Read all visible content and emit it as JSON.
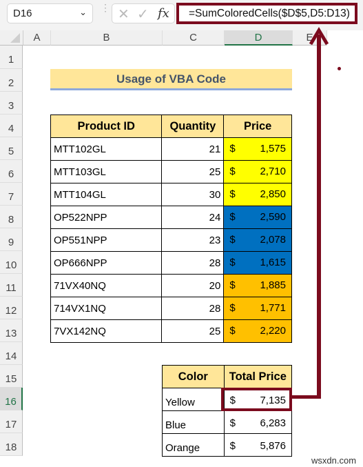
{
  "toolbar": {
    "name_box": "D16",
    "name_box_chevron": "⌄",
    "cancel_icon": "✕",
    "enter_icon": "✓",
    "fx_label": "fx",
    "formula": "=SumColoredCells($D$5,D5:D13)"
  },
  "columns": [
    "A",
    "B",
    "C",
    "D",
    "E"
  ],
  "selected_column": "D",
  "rows": [
    "1",
    "2",
    "3",
    "4",
    "5",
    "6",
    "7",
    "8",
    "9",
    "10",
    "11",
    "12",
    "13",
    "14",
    "15",
    "16",
    "17",
    "18"
  ],
  "selected_row": "16",
  "sheet": {
    "title": "Usage of VBA Code",
    "main_table": {
      "headers": [
        "Product ID",
        "Quantity",
        "Price"
      ],
      "rows": [
        {
          "id": "MTT102GL",
          "qty": "21",
          "cur": "$",
          "price": "1,575",
          "color": "#ffff00"
        },
        {
          "id": "MTT103GL",
          "qty": "25",
          "cur": "$",
          "price": "2,710",
          "color": "#ffff00"
        },
        {
          "id": "MTT104GL",
          "qty": "30",
          "cur": "$",
          "price": "2,850",
          "color": "#ffff00"
        },
        {
          "id": "OP522NPP",
          "qty": "24",
          "cur": "$",
          "price": "2,590",
          "color": "#0070c0"
        },
        {
          "id": "OP551NPP",
          "qty": "23",
          "cur": "$",
          "price": "2,078",
          "color": "#0070c0"
        },
        {
          "id": "OP666NPP",
          "qty": "28",
          "cur": "$",
          "price": "1,615",
          "color": "#0070c0"
        },
        {
          "id": "71VX40NQ",
          "qty": "20",
          "cur": "$",
          "price": "1,885",
          "color": "#ffc000"
        },
        {
          "id": "714VX1NQ",
          "qty": "28",
          "cur": "$",
          "price": "1,771",
          "color": "#ffc000"
        },
        {
          "id": "7VX142NQ",
          "qty": "25",
          "cur": "$",
          "price": "2,220",
          "color": "#ffc000"
        }
      ]
    },
    "summary_table": {
      "headers": [
        "Color",
        "Total Price"
      ],
      "rows": [
        {
          "color": "Yellow",
          "cur": "$",
          "total": "7,135"
        },
        {
          "color": "Blue",
          "cur": "$",
          "total": "6,283"
        },
        {
          "color": "Orange",
          "cur": "$",
          "total": "5,876"
        }
      ]
    }
  },
  "accent_color": "#7b0b1e",
  "watermark": "wsxdn.com"
}
